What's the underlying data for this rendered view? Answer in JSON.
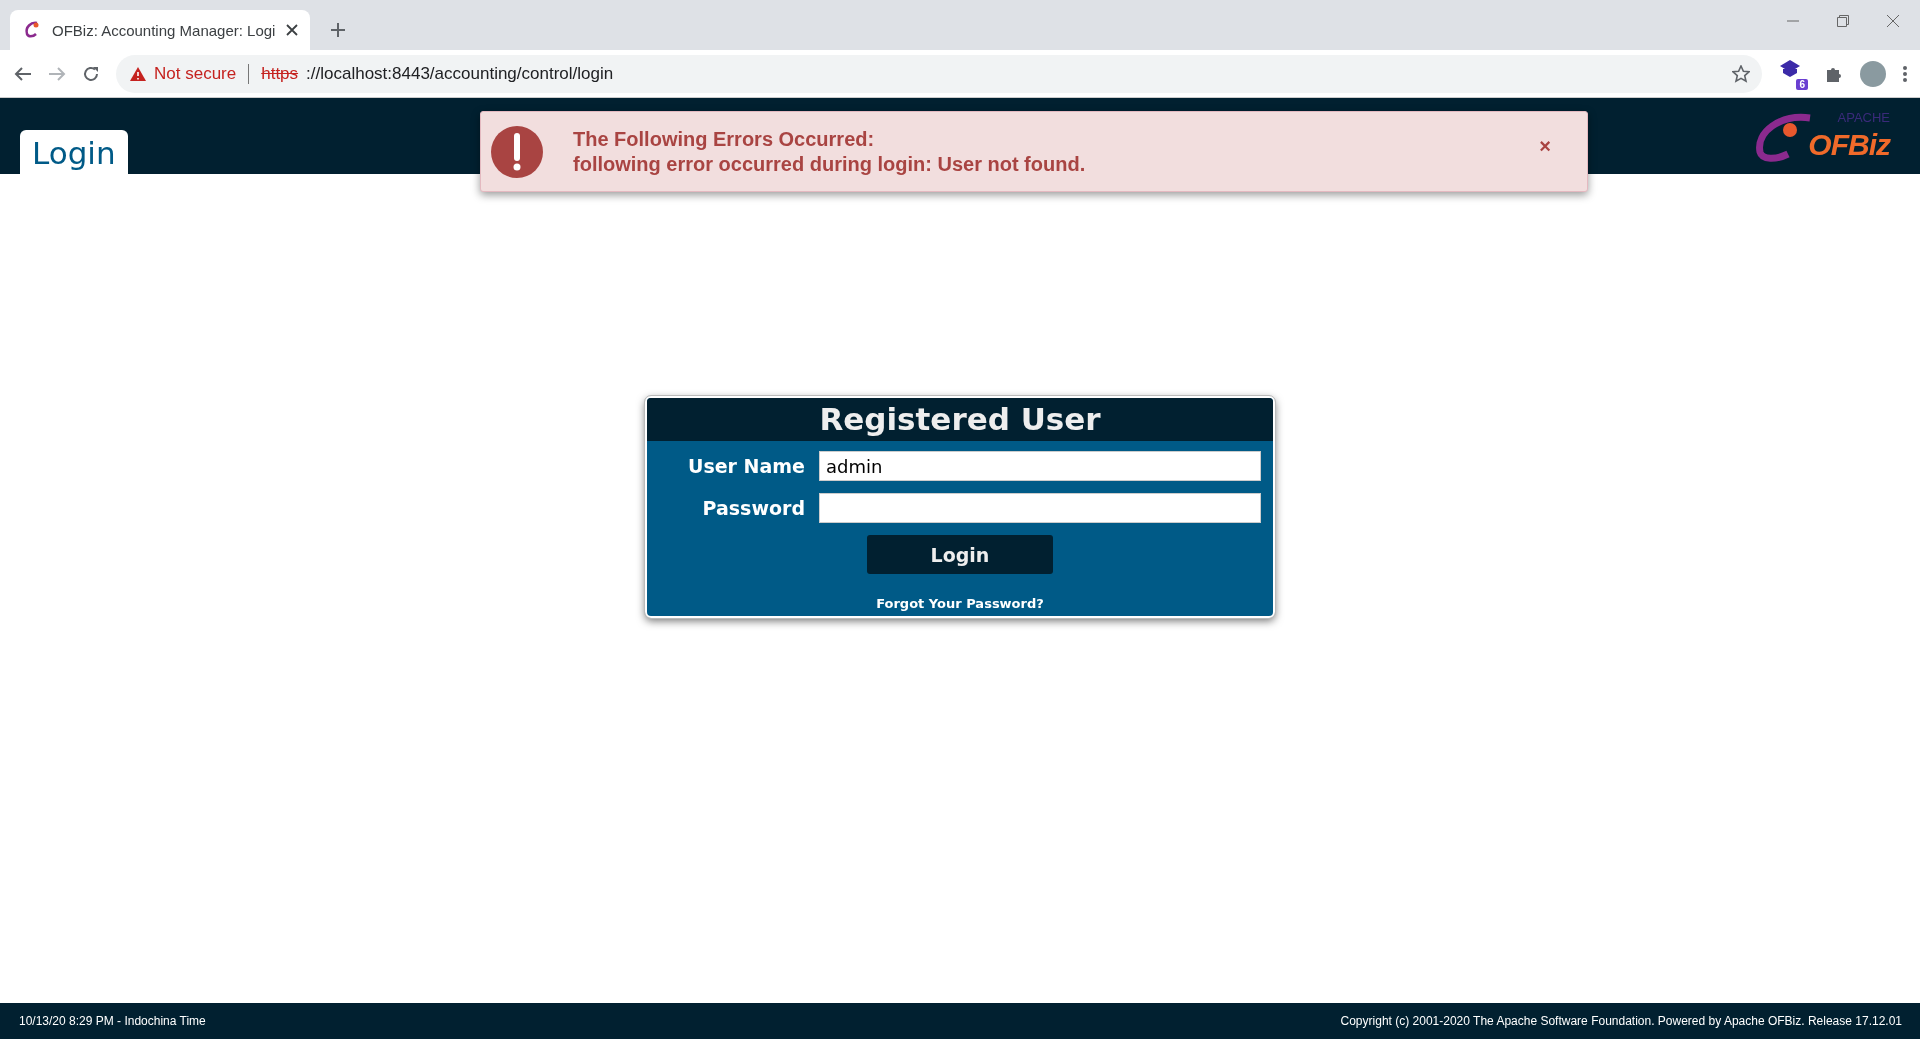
{
  "browser": {
    "tab": {
      "title": "OFBiz: Accounting Manager: Logi",
      "selected": true
    },
    "security": "Not secure",
    "url_scheme": "https",
    "url_rest": "://localhost:8443/accounting/control/login",
    "extension_badge": "6"
  },
  "header": {
    "tab": {
      "label": "Login",
      "selected": true
    },
    "logo": {
      "tagline": "APACHE",
      "name": "OFBiz"
    }
  },
  "error": {
    "title": "The Following Errors Occurred:",
    "message": "following error occurred during login: User not found.",
    "close": "×"
  },
  "login": {
    "title": "Registered User",
    "fields": [
      {
        "label": "User Name",
        "value": "admin",
        "kind": "text"
      },
      {
        "label": "Password",
        "kind": "password"
      }
    ],
    "button": "Login",
    "forgot": "Forgot Your Password?"
  },
  "footer": {
    "left": "10/13/20 8:29 PM - Indochina Time",
    "right": "Copyright (c) 2001-2020 The Apache Software Foundation. Powered by Apache OFBiz. Release 17.12.01"
  }
}
